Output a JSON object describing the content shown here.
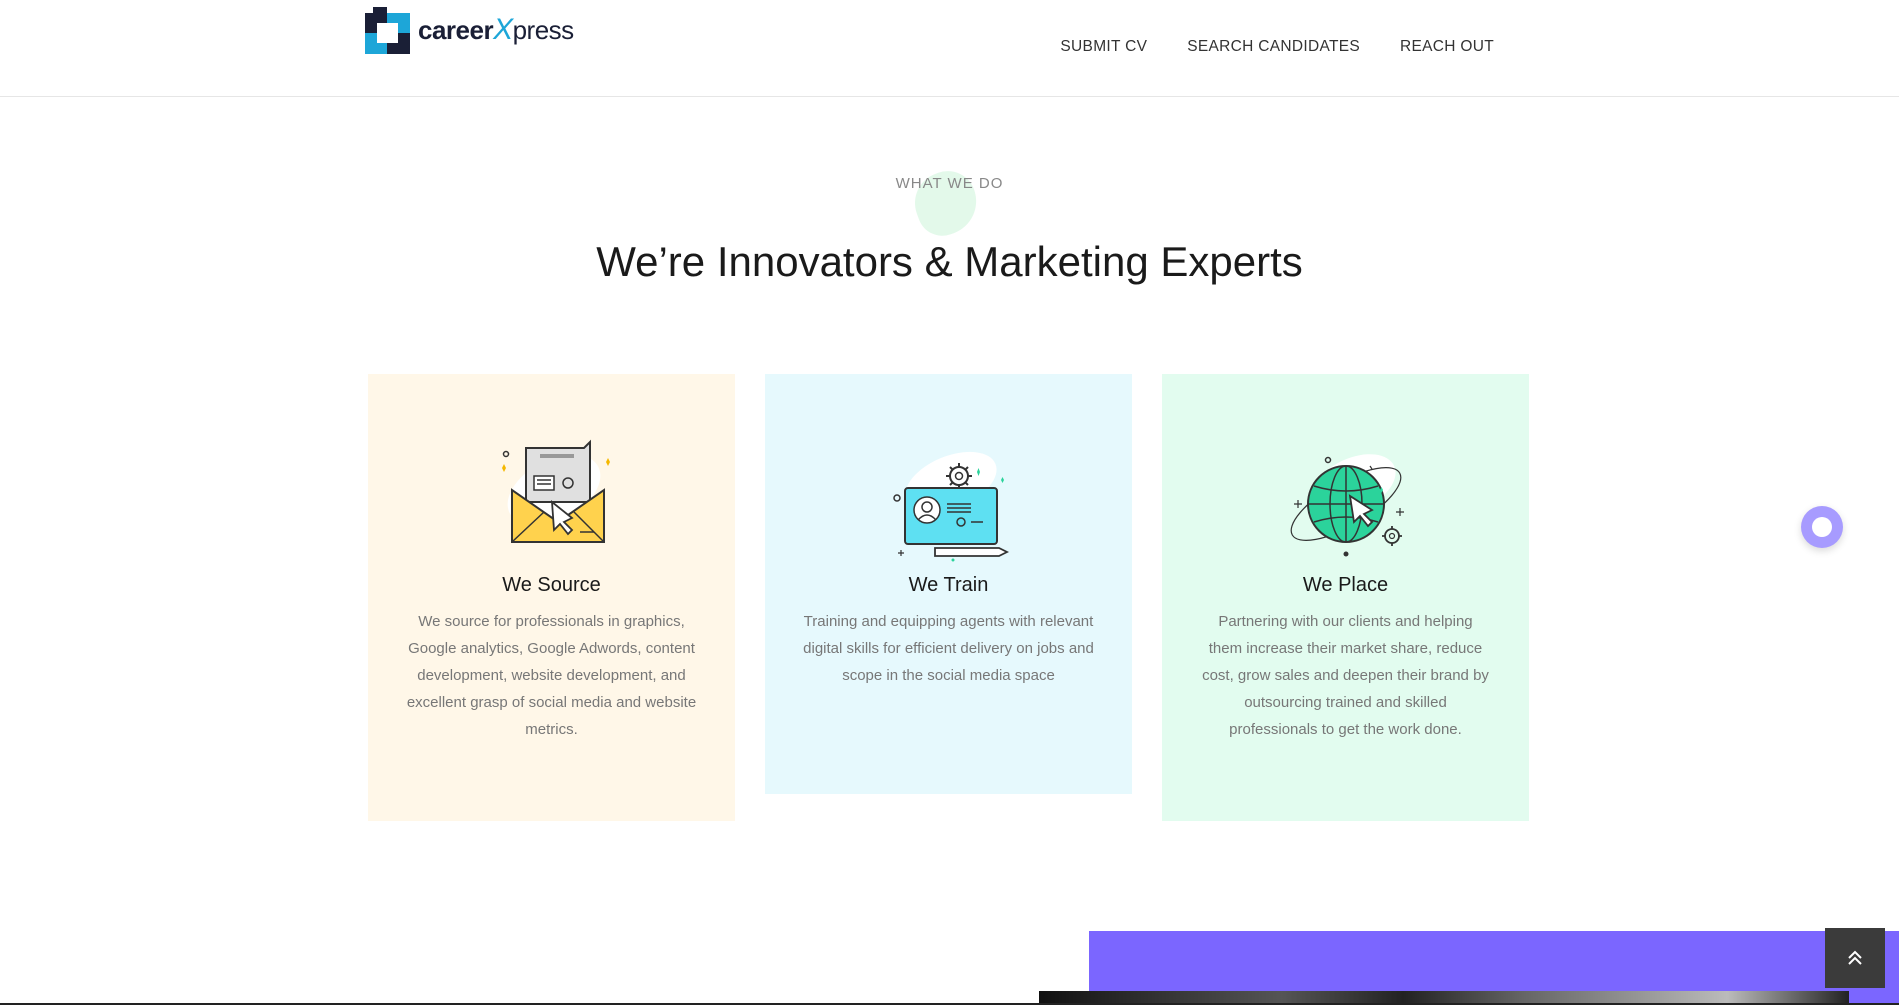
{
  "header": {
    "logo": {
      "part1": "career",
      "part2": "X",
      "part3": "press"
    },
    "nav": [
      {
        "label": "SUBMIT CV"
      },
      {
        "label": "SEARCH CANDIDATES"
      },
      {
        "label": "REACH OUT"
      }
    ]
  },
  "section": {
    "eyebrow": "WHAT WE DO",
    "headline": "We’re Innovators & Marketing Experts"
  },
  "cards": [
    {
      "title": "We Source",
      "text": "We source for professionals in graphics, Google analytics, Google Adwords, content development, website development, and excellent grasp of social media and website metrics.",
      "icon": "envelope-icon",
      "bg": "#fff7e8"
    },
    {
      "title": "We Train",
      "text": "Training and equipping agents with relevant digital skills for efficient delivery on jobs and scope in the social media space",
      "icon": "laptop-profile-icon",
      "bg": "#e6f9fd"
    },
    {
      "title": "We Place",
      "text": "Partnering with our clients and helping them increase their market share, reduce cost, grow sales and deepen their brand by outsourcing trained and skilled professionals to get the work done.",
      "icon": "globe-icon",
      "bg": "#e2fcef"
    }
  ],
  "colors": {
    "brand_dark": "#1a1f36",
    "brand_blue": "#1da6d8",
    "accent_purple": "#7b66ff",
    "chat_bubble": "#a79bff"
  }
}
